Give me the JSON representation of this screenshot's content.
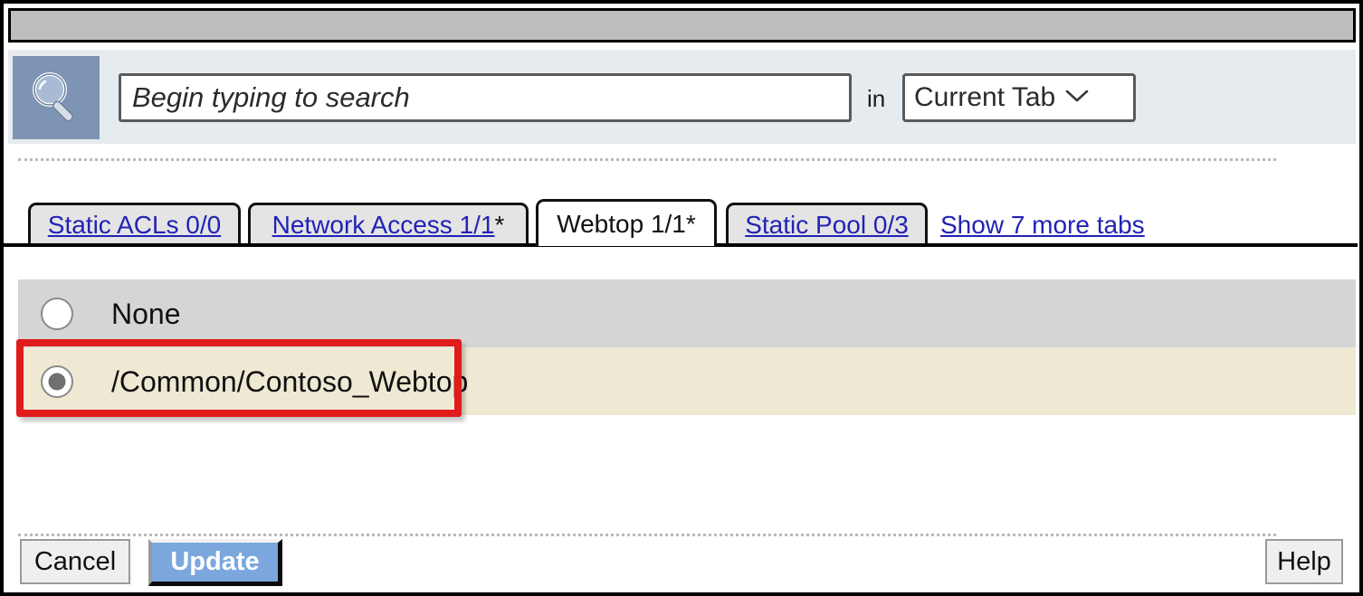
{
  "window": {
    "title": ""
  },
  "search": {
    "icon": "magnifier-icon",
    "placeholder": "Begin typing to search",
    "value": "",
    "in_label": "in",
    "scope_selected": "Current Tab",
    "scope_caret_icon": "chevron-down-icon"
  },
  "tabs": {
    "items": [
      {
        "label": "Static ACLs 0/0",
        "active": false,
        "modified": false
      },
      {
        "label": "Network Access 1/1",
        "active": false,
        "modified": true
      },
      {
        "label": "Webtop 1/1",
        "active": true,
        "modified": true
      },
      {
        "label": "Static Pool 0/3",
        "active": false,
        "modified": false
      }
    ],
    "star": "*",
    "show_more": "Show 7 more tabs"
  },
  "options": {
    "items": [
      {
        "label": "None",
        "selected": false
      },
      {
        "label": "/Common/Contoso_Webtop",
        "selected": true
      }
    ]
  },
  "footer": {
    "cancel_label": "Cancel",
    "update_label": "Update",
    "help_label": "Help"
  },
  "colors": {
    "accent_blue": "#7ba7dd",
    "link_blue": "#2222b5",
    "highlight_red": "#e01b1b",
    "search_bar_bg": "#e6ebf0",
    "icon_box_blue": "#7e94b4",
    "row_gray": "#d5d5d5",
    "row_beige": "#efe9d4",
    "titlebar_gray": "#bdbdbd"
  }
}
